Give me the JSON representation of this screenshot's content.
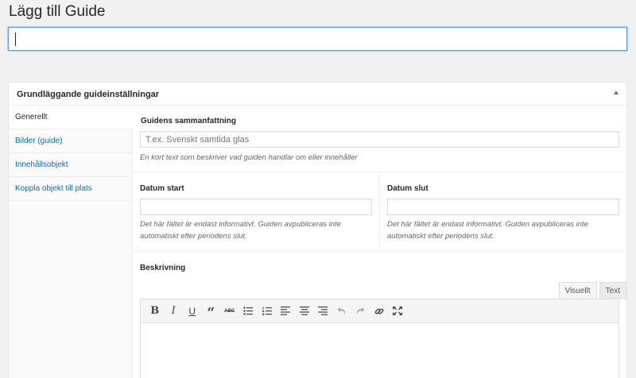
{
  "page": {
    "title": "Lägg till Guide"
  },
  "title_input": {
    "value": ""
  },
  "metabox": {
    "title": "Grundläggande guideinställningar",
    "tabs": [
      {
        "label": "Generellt",
        "active": true
      },
      {
        "label": "Bilder (guide)",
        "active": false
      },
      {
        "label": "Innehållsobjekt",
        "active": false
      },
      {
        "label": "Koppla objekt till plats",
        "active": false
      }
    ]
  },
  "summary": {
    "label": "Guidens sammanfattning",
    "placeholder": "T.ex. Svenskt samtida glas",
    "description": "En kort text som beskriver vad guiden handlar om eller innehåller"
  },
  "date_start": {
    "label": "Datum start",
    "value": "",
    "description": "Det här fältet är endast informativt. Guiden avpubliceras inte automatiskt efter periodens slut."
  },
  "date_end": {
    "label": "Datum slut",
    "value": "",
    "description": "Det här fältet är endast informativt. Guiden avpubliceras inte automatiskt efter periodens slut."
  },
  "editor": {
    "label": "Beskrivning",
    "tab_visual": "Visuellt",
    "tab_text": "Text",
    "toolbar": [
      "bold-icon",
      "italic-icon",
      "underline-icon",
      "blockquote-icon",
      "strikethrough-icon",
      "bullet-list-icon",
      "numbered-list-icon",
      "align-left-icon",
      "align-center-icon",
      "align-right-icon",
      "undo-icon",
      "redo-icon",
      "link-icon",
      "fullscreen-icon"
    ],
    "content": ""
  },
  "colors": {
    "accent": "#0073aa",
    "focus_border": "#5b9dd9",
    "background": "#f1f1f1"
  }
}
